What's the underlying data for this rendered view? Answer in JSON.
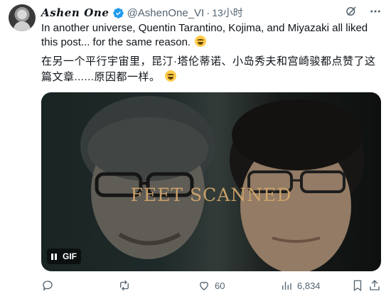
{
  "author": {
    "name": "Ashen One",
    "handle": "@AshenOne_VI",
    "dot": "·",
    "time": "13小时"
  },
  "tweet": {
    "text_en": "In another universe, Quentin Tarantino, Kojima, and Miyazaki all liked this post... for the same reason.",
    "text_zh": "在另一个平行宇宙里，昆汀·塔伦蒂诺、小岛秀夫和宫崎骏都点赞了这篇文章......原因都一样。"
  },
  "media": {
    "caption": "FEET SCANNED",
    "badge": "GIF"
  },
  "stats": {
    "replies": "",
    "retweets": "",
    "likes": "60",
    "views": "6,834"
  },
  "icons": {
    "verified": "verified-badge-icon",
    "grok": "grok-icon",
    "more": "more-icon",
    "reply": "reply-icon",
    "retweet": "retweet-icon",
    "like": "heart-icon",
    "views": "views-icon",
    "bookmark": "bookmark-icon",
    "share": "share-icon"
  },
  "colors": {
    "text": "#0f1419",
    "secondary": "#536471",
    "verified": "#1d9bf0",
    "caption": "#d4a86c"
  }
}
